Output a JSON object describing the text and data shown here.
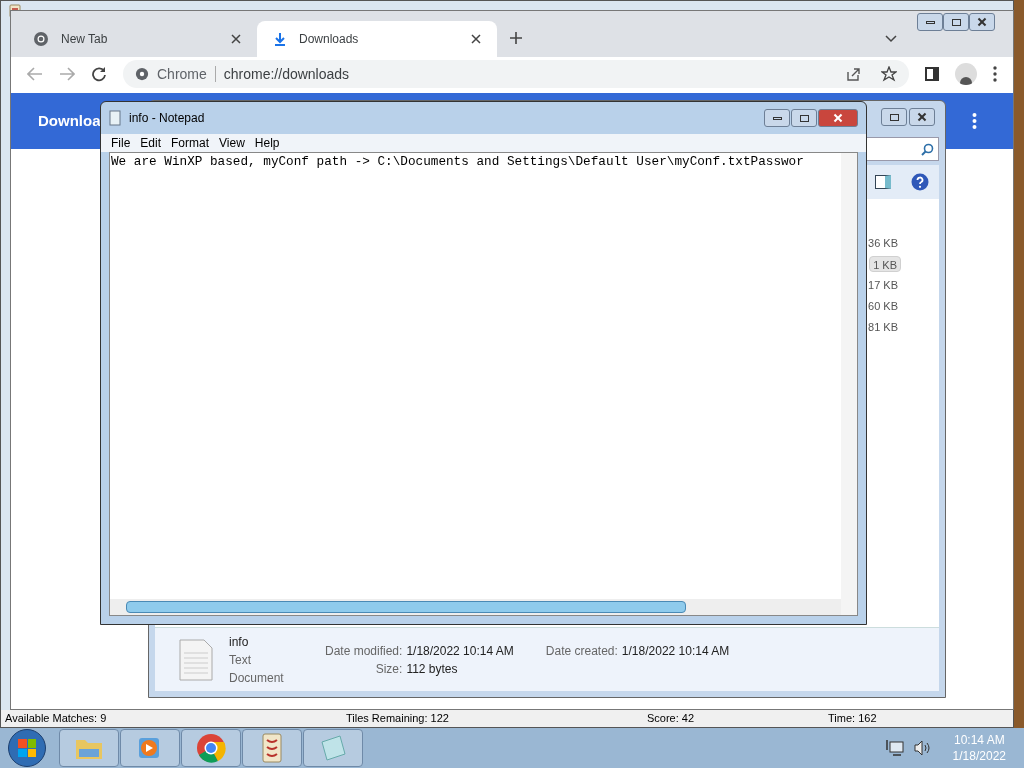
{
  "game_window": {
    "status": [
      "Available Matches: 9",
      "Tiles Remaining: 122",
      "Score: 42",
      "Time: 162"
    ]
  },
  "browser": {
    "tabs": [
      {
        "label": "New Tab",
        "selected": false
      },
      {
        "label": "Downloads",
        "selected": true
      }
    ],
    "address": {
      "site": "Chrome",
      "url": "chrome://downloads"
    },
    "page_title": "Downloa"
  },
  "explorer": {
    "sizes": [
      {
        "text": "36 KB",
        "selected": false
      },
      {
        "text": "1 KB",
        "selected": true
      },
      {
        "text": "17 KB",
        "selected": false
      },
      {
        "text": "60 KB",
        "selected": false
      },
      {
        "text": "81 KB",
        "selected": false
      }
    ],
    "details": {
      "name": "info",
      "type": "Text Document",
      "fields": [
        {
          "label": "Date modified:",
          "value": "1/18/2022 10:14 AM"
        },
        {
          "label": "Date created:",
          "value": "1/18/2022 10:14 AM"
        },
        {
          "label": "Size:",
          "value": "112 bytes"
        }
      ]
    }
  },
  "notepad": {
    "title": "info - Notepad",
    "menu": [
      "File",
      "Edit",
      "Format",
      "View",
      "Help"
    ],
    "text": "We are WinXP based, myConf path -> C:\\Documents and Settings\\Default User\\myConf.txtPasswor"
  },
  "taskbar": {
    "apps": [
      {
        "kind": "folder"
      },
      {
        "kind": "media"
      },
      {
        "kind": "chrome"
      },
      {
        "kind": "mahjong"
      },
      {
        "kind": "notepad"
      }
    ],
    "time": "10:14 AM",
    "date": "1/18/2022"
  }
}
